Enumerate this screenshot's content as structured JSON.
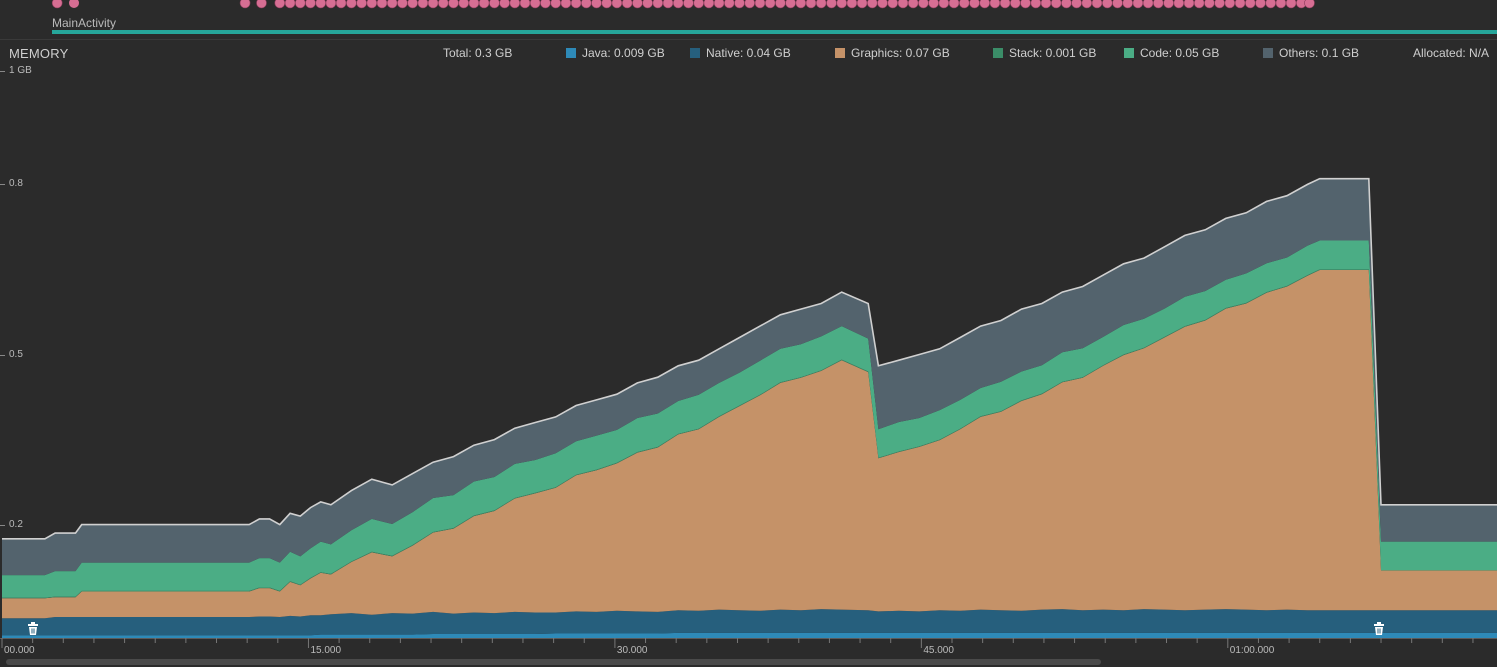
{
  "session": {
    "activity_name": "MainActivity"
  },
  "monitor": {
    "title": "MEMORY",
    "total_label": "Total: 0.3 GB",
    "allocated_label": "Allocated: N/A"
  },
  "legend": [
    {
      "key": "java",
      "label": "Java: 0.009 GB",
      "color": "#2e8ab8"
    },
    {
      "key": "native",
      "label": "Native: 0.04 GB",
      "color": "#265f7d"
    },
    {
      "key": "graphics",
      "label": "Graphics: 0.07 GB",
      "color": "#c59268"
    },
    {
      "key": "stack",
      "label": "Stack: 0.001 GB",
      "color": "#3b8d68"
    },
    {
      "key": "code",
      "label": "Code: 0.05 GB",
      "color": "#4bad85"
    },
    {
      "key": "others",
      "label": "Others: 0.1 GB",
      "color": "#53636d"
    }
  ],
  "icons": {
    "gc": "trash-icon",
    "event": "touch-event-icon"
  },
  "chart_data": {
    "type": "area",
    "stacked": true,
    "x_unit": "seconds",
    "xlim": [
      0,
      73.5
    ],
    "ylim": [
      0,
      1.0
    ],
    "y_tick_labels": [
      {
        "value": 1.0,
        "label": "1 GB"
      },
      {
        "value": 0.8,
        "label": "0.8"
      },
      {
        "value": 0.5,
        "label": "0.5"
      },
      {
        "value": 0.2,
        "label": "0.2"
      }
    ],
    "x_tick_labels": [
      {
        "value": 0,
        "label": "00.000"
      },
      {
        "value": 15,
        "label": "15.000"
      },
      {
        "value": 30,
        "label": "30.000"
      },
      {
        "value": 45,
        "label": "45.000"
      },
      {
        "value": 60,
        "label": "01:00.000"
      }
    ],
    "x": [
      0,
      2.1,
      2.6,
      3.6,
      3.9,
      12.1,
      12.6,
      13.1,
      13.6,
      14.1,
      14.6,
      15.1,
      15.6,
      16.1,
      17.1,
      18.1,
      19.1,
      20.1,
      21.1,
      22.1,
      23.1,
      24.1,
      25.1,
      26.1,
      27.1,
      28.1,
      29.1,
      30.1,
      31.1,
      32.1,
      33.1,
      34.1,
      35.1,
      36.1,
      37.1,
      38.1,
      39.1,
      40.1,
      41.1,
      42.4,
      42.9,
      43.9,
      44.9,
      45.9,
      46.9,
      47.9,
      48.9,
      49.9,
      50.9,
      51.9,
      52.9,
      53.9,
      54.9,
      55.9,
      56.9,
      57.9,
      58.9,
      59.9,
      60.9,
      61.9,
      62.9,
      63.9,
      64.5,
      66.9,
      67.5,
      73.5
    ],
    "total": [
      0.175,
      0.175,
      0.185,
      0.185,
      0.2,
      0.2,
      0.21,
      0.21,
      0.2,
      0.22,
      0.215,
      0.23,
      0.24,
      0.235,
      0.26,
      0.28,
      0.27,
      0.29,
      0.31,
      0.32,
      0.34,
      0.35,
      0.37,
      0.38,
      0.39,
      0.41,
      0.42,
      0.43,
      0.45,
      0.46,
      0.48,
      0.49,
      0.51,
      0.53,
      0.55,
      0.57,
      0.58,
      0.59,
      0.61,
      0.59,
      0.48,
      0.49,
      0.5,
      0.51,
      0.53,
      0.55,
      0.56,
      0.58,
      0.59,
      0.61,
      0.62,
      0.64,
      0.66,
      0.67,
      0.69,
      0.71,
      0.72,
      0.74,
      0.75,
      0.77,
      0.78,
      0.8,
      0.81,
      0.81,
      0.235,
      0.235
    ],
    "series": [
      {
        "name": "Java",
        "values": [
          0.005,
          0.005,
          0.005,
          0.005,
          0.005,
          0.005,
          0.005,
          0.005,
          0.005,
          0.005,
          0.005,
          0.005,
          0.006,
          0.006,
          0.006,
          0.006,
          0.006,
          0.006,
          0.007,
          0.007,
          0.007,
          0.007,
          0.007,
          0.007,
          0.008,
          0.008,
          0.008,
          0.008,
          0.008,
          0.008,
          0.009,
          0.009,
          0.009,
          0.009,
          0.009,
          0.009,
          0.009,
          0.009,
          0.009,
          0.009,
          0.009,
          0.009,
          0.009,
          0.009,
          0.009,
          0.009,
          0.009,
          0.009,
          0.009,
          0.009,
          0.009,
          0.009,
          0.009,
          0.009,
          0.009,
          0.009,
          0.009,
          0.009,
          0.009,
          0.009,
          0.009,
          0.009,
          0.009,
          0.009,
          0.009,
          0.009
        ]
      },
      {
        "name": "Native",
        "values": [
          0.03,
          0.03,
          0.032,
          0.032,
          0.032,
          0.032,
          0.033,
          0.033,
          0.032,
          0.034,
          0.033,
          0.035,
          0.034,
          0.036,
          0.038,
          0.035,
          0.038,
          0.037,
          0.039,
          0.036,
          0.038,
          0.037,
          0.039,
          0.038,
          0.037,
          0.039,
          0.038,
          0.04,
          0.039,
          0.038,
          0.04,
          0.039,
          0.041,
          0.04,
          0.039,
          0.041,
          0.04,
          0.042,
          0.041,
          0.04,
          0.038,
          0.039,
          0.038,
          0.04,
          0.039,
          0.041,
          0.04,
          0.039,
          0.041,
          0.042,
          0.04,
          0.041,
          0.04,
          0.042,
          0.041,
          0.04,
          0.041,
          0.042,
          0.041,
          0.04,
          0.041,
          0.04,
          0.04,
          0.04,
          0.04,
          0.04
        ]
      },
      {
        "name": "Graphics",
        "values": [
          0.035,
          0.035,
          0.035,
          0.035,
          0.045,
          0.045,
          0.05,
          0.05,
          0.045,
          0.06,
          0.055,
          0.065,
          0.075,
          0.07,
          0.09,
          0.11,
          0.1,
          0.12,
          0.14,
          0.15,
          0.17,
          0.18,
          0.2,
          0.21,
          0.22,
          0.24,
          0.25,
          0.26,
          0.28,
          0.29,
          0.31,
          0.32,
          0.34,
          0.36,
          0.38,
          0.4,
          0.41,
          0.42,
          0.44,
          0.42,
          0.27,
          0.28,
          0.29,
          0.3,
          0.32,
          0.34,
          0.35,
          0.37,
          0.38,
          0.4,
          0.41,
          0.43,
          0.45,
          0.46,
          0.48,
          0.5,
          0.51,
          0.53,
          0.54,
          0.56,
          0.57,
          0.59,
          0.6,
          0.6,
          0.07,
          0.07
        ]
      },
      {
        "name": "Stack",
        "values": [
          0.001,
          0.001,
          0.001,
          0.001,
          0.001,
          0.001,
          0.001,
          0.001,
          0.001,
          0.001,
          0.001,
          0.001,
          0.001,
          0.001,
          0.001,
          0.001,
          0.001,
          0.001,
          0.001,
          0.001,
          0.001,
          0.001,
          0.001,
          0.001,
          0.001,
          0.001,
          0.001,
          0.001,
          0.001,
          0.001,
          0.001,
          0.001,
          0.001,
          0.001,
          0.001,
          0.001,
          0.001,
          0.001,
          0.001,
          0.001,
          0.001,
          0.001,
          0.001,
          0.001,
          0.001,
          0.001,
          0.001,
          0.001,
          0.001,
          0.001,
          0.001,
          0.001,
          0.001,
          0.001,
          0.001,
          0.001,
          0.001,
          0.001,
          0.001,
          0.001,
          0.001,
          0.001,
          0.001,
          0.001,
          0.001,
          0.001
        ]
      },
      {
        "name": "Code",
        "values": [
          0.04,
          0.04,
          0.045,
          0.045,
          0.05,
          0.05,
          0.052,
          0.052,
          0.05,
          0.052,
          0.05,
          0.052,
          0.054,
          0.052,
          0.055,
          0.058,
          0.056,
          0.058,
          0.06,
          0.058,
          0.06,
          0.059,
          0.06,
          0.058,
          0.06,
          0.059,
          0.06,
          0.058,
          0.06,
          0.059,
          0.058,
          0.06,
          0.059,
          0.058,
          0.06,
          0.059,
          0.058,
          0.06,
          0.059,
          0.058,
          0.05,
          0.052,
          0.05,
          0.052,
          0.051,
          0.05,
          0.052,
          0.051,
          0.05,
          0.052,
          0.051,
          0.05,
          0.052,
          0.051,
          0.05,
          0.052,
          0.051,
          0.05,
          0.052,
          0.051,
          0.05,
          0.052,
          0.051,
          0.051,
          0.05,
          0.05
        ]
      },
      {
        "name": "Others",
        "values": [
          0.064,
          0.064,
          0.067,
          0.067,
          0.067,
          0.067,
          0.069,
          0.069,
          0.067,
          0.068,
          0.071,
          0.072,
          0.07,
          0.07,
          0.07,
          0.07,
          0.069,
          0.069,
          0.063,
          0.069,
          0.065,
          0.067,
          0.064,
          0.068,
          0.065,
          0.064,
          0.064,
          0.064,
          0.063,
          0.064,
          0.063,
          0.061,
          0.06,
          0.062,
          0.061,
          0.06,
          0.062,
          0.058,
          0.06,
          0.062,
          0.112,
          0.109,
          0.112,
          0.107,
          0.11,
          0.109,
          0.108,
          0.11,
          0.109,
          0.106,
          0.108,
          0.109,
          0.108,
          0.107,
          0.109,
          0.108,
          0.108,
          0.107,
          0.107,
          0.109,
          0.109,
          0.108,
          0.109,
          0.109,
          0.065,
          0.065
        ]
      }
    ],
    "gc_event_x": [
      1.5,
      67.4
    ],
    "touch_event_x": [
      2.7,
      11.9,
      12.7,
      13.6,
      14.1,
      14.6,
      15.1,
      15.6,
      16.1,
      16.6,
      17.1,
      17.6,
      18.1,
      18.6,
      19.1,
      19.6,
      20.1,
      20.6,
      21.1,
      21.6,
      22.1,
      22.6,
      23.1,
      23.6,
      24.1,
      24.6,
      25.1,
      25.6,
      26.1,
      26.6,
      27.1,
      27.6,
      28.1,
      28.6,
      29.1,
      29.6,
      30.1,
      30.6,
      31.1,
      31.6,
      32.1,
      32.6,
      33.1,
      33.6,
      34.1,
      34.6,
      35.1,
      35.6,
      36.1,
      36.6,
      37.1,
      37.6,
      38.1,
      38.6,
      39.1,
      39.6,
      40.1,
      40.6,
      41.1,
      41.6,
      42.1,
      42.6,
      43.1,
      43.6,
      44.1,
      44.6,
      45.1,
      45.6,
      46.1,
      46.6,
      47.1,
      47.6,
      48.1,
      48.6,
      49.1,
      49.6,
      50.1,
      50.6,
      51.1,
      51.6,
      52.1,
      52.6,
      53.1,
      53.6,
      54.1,
      54.6,
      55.1,
      55.6,
      56.1,
      56.6,
      57.1,
      57.6,
      58.1,
      58.6,
      59.1,
      59.6,
      60.1,
      60.6,
      61.1,
      61.6,
      62.1,
      62.6,
      63.1,
      63.6,
      64.0
    ]
  }
}
